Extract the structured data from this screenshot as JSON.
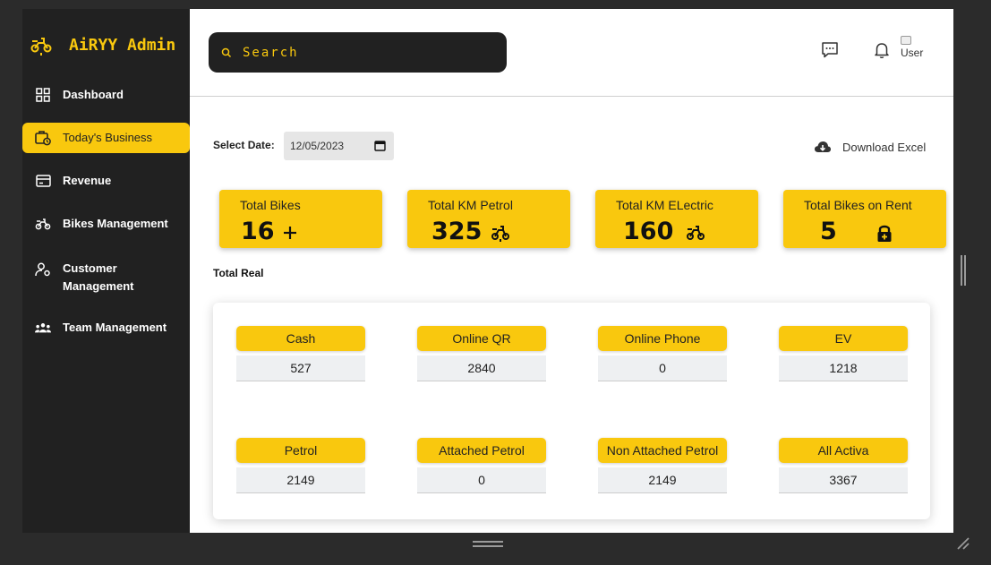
{
  "brand": {
    "title": "AiRYY Admin"
  },
  "sidebar": {
    "items": [
      {
        "label": "Dashboard",
        "icon": "grid-icon",
        "active": false
      },
      {
        "label": "Today's Business",
        "icon": "briefcase-clock-icon",
        "active": true
      },
      {
        "label": "Revenue",
        "icon": "card-icon",
        "active": false
      },
      {
        "label": "Bikes Management",
        "icon": "scooter-icon",
        "active": false
      },
      {
        "label": "Customer Management",
        "icon": "user-settings-icon",
        "active": false
      },
      {
        "label": "Team Management",
        "icon": "team-icon",
        "active": false
      }
    ]
  },
  "header": {
    "search_placeholder": "Search",
    "user_alt": "User"
  },
  "filters": {
    "date_label": "Select Date:",
    "date_value": "12/05/2023",
    "download_label": "Download Excel"
  },
  "stats": [
    {
      "label": "Total Bikes",
      "value": "16",
      "icon": "plus-icon"
    },
    {
      "label": "Total KM Petrol",
      "value": "325",
      "icon": "scooter-icon"
    },
    {
      "label": "Total KM ELectric",
      "value": "160",
      "icon": "scooter-icon"
    },
    {
      "label": "Total Bikes on Rent",
      "value": "5",
      "icon": "lock-icon"
    }
  ],
  "total_real": {
    "title": "Total Real",
    "metrics": [
      {
        "label": "Cash",
        "value": "527"
      },
      {
        "label": "Online QR",
        "value": "2840"
      },
      {
        "label": "Online Phone",
        "value": "0"
      },
      {
        "label": "EV",
        "value": "1218"
      },
      {
        "label": "Petrol",
        "value": "2149"
      },
      {
        "label": "Attached Petrol",
        "value": "0"
      },
      {
        "label": "Non Attached Petrol",
        "value": "2149"
      },
      {
        "label": "All Activa",
        "value": "3367"
      }
    ]
  },
  "colors": {
    "accent": "#f9c80e",
    "sidebar": "#212121",
    "frame": "#2b2b2b"
  }
}
